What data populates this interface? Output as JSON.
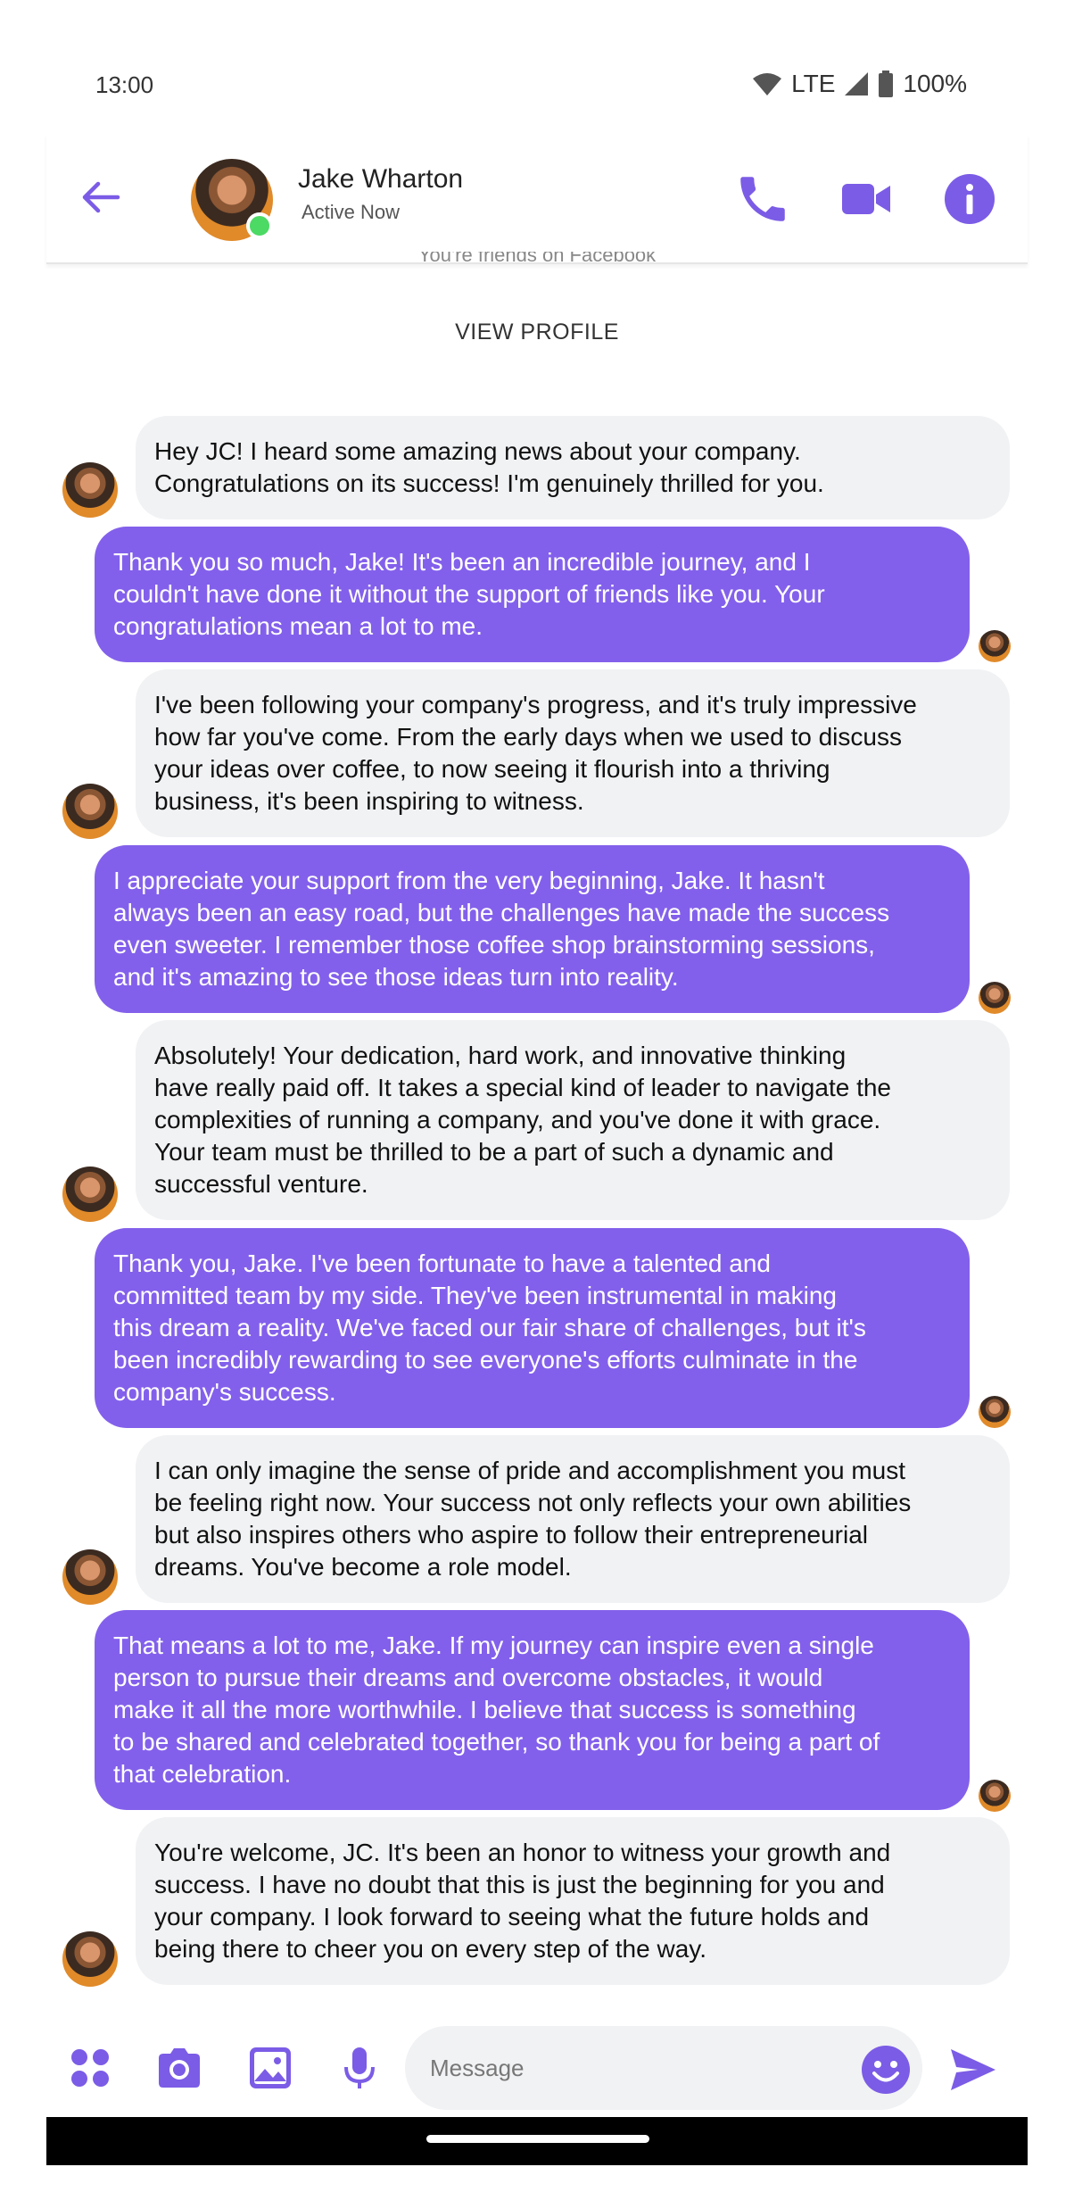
{
  "status_bar": {
    "time": "13:00",
    "network": "LTE",
    "battery": "100%"
  },
  "header": {
    "contact_name": "Jake Wharton",
    "contact_status": "Active Now"
  },
  "profile": {
    "peek_text": "You're friends on Facebook",
    "view_profile_label": "VIEW PROFILE"
  },
  "messages": [
    {
      "sender": "Jake",
      "text": "Hey JC! I heard some amazing news about your company.\nCongratulations on its success! I'm genuinely thrilled for you."
    },
    {
      "sender": "JC",
      "text": "Thank you so much, Jake! It's been an incredible journey, and I\ncouldn't have done it without the support of friends like you. Your\ncongratulations mean a lot to me."
    },
    {
      "sender": "Jake",
      "text": "I've been following your company's progress, and it's truly impressive\nhow far you've come. From the early days when we used to discuss\nyour ideas over coffee, to now seeing it flourish into a thriving\nbusiness, it's been inspiring to witness."
    },
    {
      "sender": "JC",
      "text": "I appreciate your support from the very beginning, Jake. It hasn't\nalways been an easy road, but the challenges have made the success\neven sweeter. I remember those coffee shop brainstorming sessions,\nand it's amazing to see those ideas turn into reality."
    },
    {
      "sender": "Jake",
      "text": "Absolutely! Your dedication, hard work, and innovative thinking\nhave really paid off. It takes a special kind of leader to navigate the\ncomplexities of running a company, and you've done it with grace.\nYour team must be thrilled to be a part of such a dynamic and\nsuccessful venture."
    },
    {
      "sender": "JC",
      "text": "Thank you, Jake. I've been fortunate to have a talented and\ncommitted team by my side. They've been instrumental in making\nthis dream a reality. We've faced our fair share of challenges, but it's\nbeen incredibly rewarding to see everyone's efforts culminate in the\ncompany's success."
    },
    {
      "sender": "Jake",
      "text": "I can only imagine the sense of pride and accomplishment you must\nbe feeling right now. Your success not only reflects your own abilities\nbut also inspires others who aspire to follow their entrepreneurial\ndreams. You've become a role model."
    },
    {
      "sender": "JC",
      "text": "That means a lot to me, Jake. If my journey can inspire even a single\nperson to pursue their dreams and overcome obstacles, it would\nmake it all the more worthwhile. I believe that success is something\nto be shared and celebrated together, so thank you for being a part of\nthat celebration."
    },
    {
      "sender": "Jake",
      "text": "You're welcome, JC. It's been an honor to witness your growth and\nsuccess. I have no doubt that this is just the beginning for you and\nyour company. I look forward to seeing what the future holds and\nbeing there to cheer you on every step of the way."
    }
  ],
  "composer": {
    "placeholder": "Message"
  },
  "colors": {
    "accent": "#8360eb",
    "incoming_bubble": "#f1f2f4",
    "online": "#4cd964"
  }
}
